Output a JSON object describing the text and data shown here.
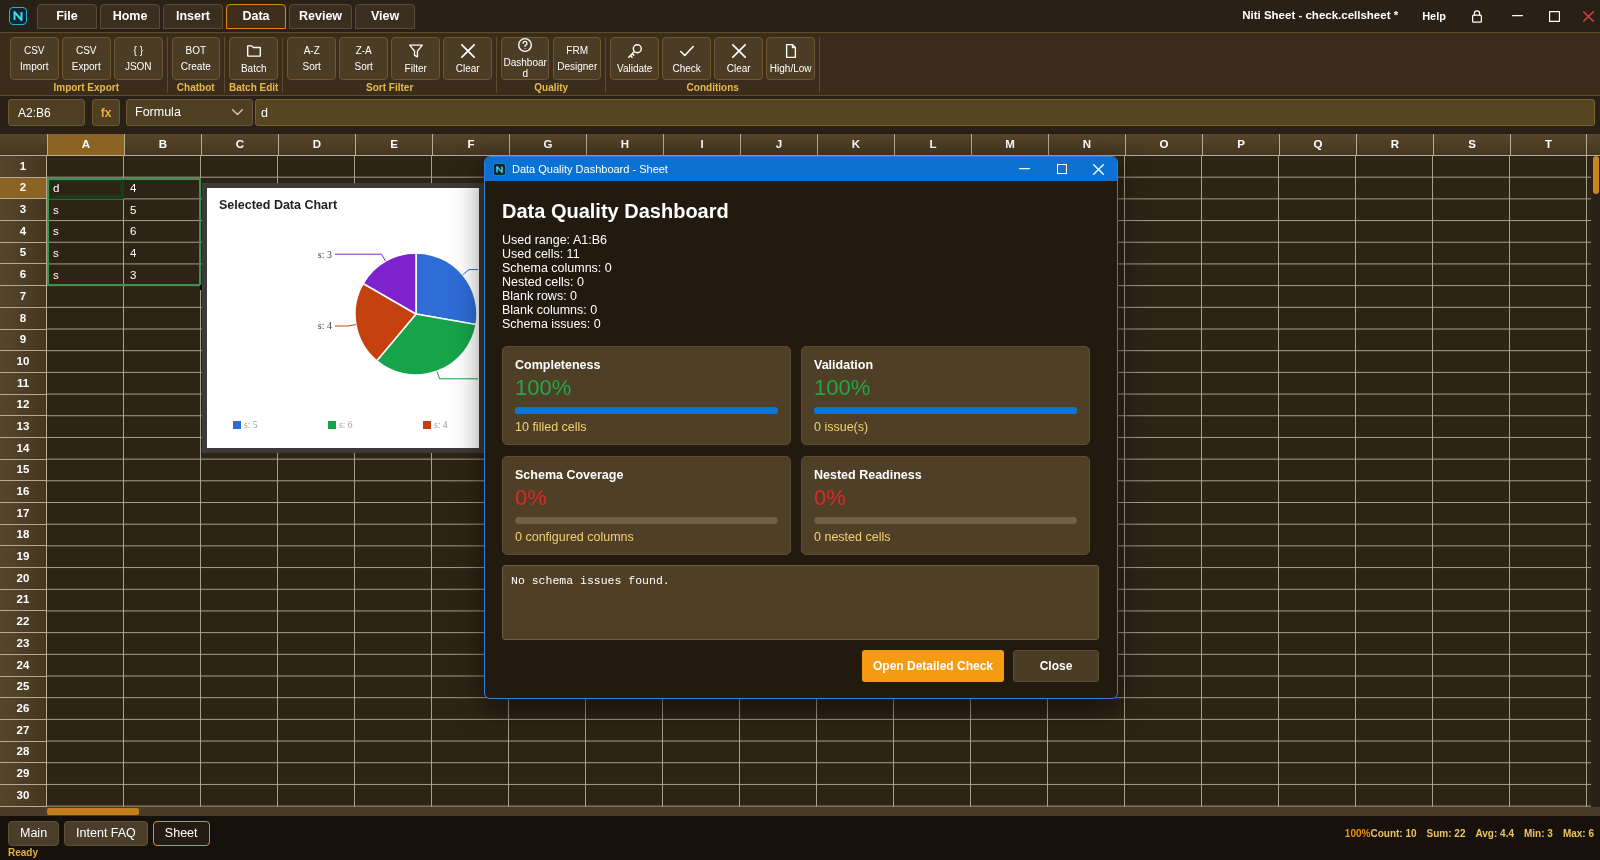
{
  "app": {
    "title": "Niti Sheet - check.cellsheet *",
    "help": "Help"
  },
  "menu_tabs": [
    {
      "label": "File",
      "selected": false
    },
    {
      "label": "Home",
      "selected": false
    },
    {
      "label": "Insert",
      "selected": false
    },
    {
      "label": "Data",
      "selected": true
    },
    {
      "label": "Review",
      "selected": false
    },
    {
      "label": "View",
      "selected": false
    }
  ],
  "ribbon": [
    {
      "label": "Import Export",
      "buttons": [
        {
          "kind": "caption",
          "caption": "CSV",
          "label": "Import"
        },
        {
          "kind": "caption",
          "caption": "CSV",
          "label": "Export"
        },
        {
          "kind": "caption",
          "caption": "{ }",
          "label": "JSON"
        }
      ]
    },
    {
      "label": "Chatbot",
      "buttons": [
        {
          "kind": "caption",
          "caption": "BOT",
          "label": "Create"
        }
      ]
    },
    {
      "label": "Batch Edit",
      "buttons": [
        {
          "kind": "folder",
          "label": "Batch"
        }
      ]
    },
    {
      "label": "Sort Filter",
      "buttons": [
        {
          "kind": "caption",
          "caption": "A-Z",
          "label": "Sort"
        },
        {
          "kind": "caption",
          "caption": "Z-A",
          "label": "Sort"
        },
        {
          "kind": "funnel",
          "label": "Filter"
        },
        {
          "kind": "cross",
          "label": "Clear"
        }
      ]
    },
    {
      "label": "Quality",
      "buttons": [
        {
          "kind": "help",
          "label": "Dashboard"
        },
        {
          "kind": "caption",
          "caption": "FRM",
          "label": "Designer"
        }
      ]
    },
    {
      "label": "Conditions",
      "buttons": [
        {
          "kind": "key",
          "label": "Validate"
        },
        {
          "kind": "tick",
          "label": "Check"
        },
        {
          "kind": "cross",
          "label": "Clear"
        },
        {
          "kind": "page",
          "label": "High/Low"
        }
      ]
    }
  ],
  "formula_bar": {
    "name_box": "A2:B6",
    "function_label": "fx",
    "mode": "Formula",
    "value": "d"
  },
  "sheet": {
    "columns": [
      {
        "label": "A",
        "selected": true
      },
      {
        "label": "B",
        "selected": false
      },
      {
        "label": "C",
        "selected": false
      },
      {
        "label": "D",
        "selected": false
      },
      {
        "label": "E",
        "selected": false
      },
      {
        "label": "F",
        "selected": false
      },
      {
        "label": "G",
        "selected": false
      },
      {
        "label": "H",
        "selected": false
      },
      {
        "label": "I",
        "selected": false
      },
      {
        "label": "J",
        "selected": false
      },
      {
        "label": "K",
        "selected": false
      },
      {
        "label": "L",
        "selected": false
      },
      {
        "label": "M",
        "selected": false
      },
      {
        "label": "N",
        "selected": false
      },
      {
        "label": "O",
        "selected": false
      },
      {
        "label": "P",
        "selected": false
      },
      {
        "label": "Q",
        "selected": false
      },
      {
        "label": "R",
        "selected": false
      },
      {
        "label": "S",
        "selected": false
      },
      {
        "label": "T",
        "selected": false
      }
    ],
    "rows": [
      {
        "label": "1",
        "selected": false
      },
      {
        "label": "2",
        "selected": true,
        "cells": [
          {
            "text": "d",
            "selected": true,
            "active": true
          },
          {
            "text": "4",
            "selected": true,
            "active": false
          }
        ]
      },
      {
        "label": "3",
        "selected": false,
        "cells": [
          {
            "text": "s",
            "selected": true,
            "active": false
          },
          {
            "text": "5",
            "selected": true,
            "active": false
          }
        ]
      },
      {
        "label": "4",
        "selected": false,
        "cells": [
          {
            "text": "s",
            "selected": true,
            "active": false
          },
          {
            "text": "6",
            "selected": true,
            "active": false
          }
        ]
      },
      {
        "label": "5",
        "selected": false,
        "cells": [
          {
            "text": "s",
            "selected": true,
            "active": false
          },
          {
            "text": "4",
            "selected": true,
            "active": false
          }
        ]
      },
      {
        "label": "6",
        "selected": false,
        "cells": [
          {
            "text": "s",
            "selected": true,
            "active": false
          },
          {
            "text": "3",
            "selected": true,
            "active": false
          }
        ]
      },
      {
        "label": "7",
        "selected": false
      },
      {
        "label": "8",
        "selected": false
      },
      {
        "label": "9",
        "selected": false
      },
      {
        "label": "10",
        "selected": false
      },
      {
        "label": "11",
        "selected": false
      },
      {
        "label": "12",
        "selected": false
      },
      {
        "label": "13",
        "selected": false
      },
      {
        "label": "14",
        "selected": false
      },
      {
        "label": "15",
        "selected": false
      },
      {
        "label": "16",
        "selected": false
      },
      {
        "label": "17",
        "selected": false
      },
      {
        "label": "18",
        "selected": false
      },
      {
        "label": "19",
        "selected": false
      },
      {
        "label": "20",
        "selected": false
      },
      {
        "label": "21",
        "selected": false
      },
      {
        "label": "22",
        "selected": false
      },
      {
        "label": "23",
        "selected": false
      },
      {
        "label": "24",
        "selected": false
      },
      {
        "label": "25",
        "selected": false
      },
      {
        "label": "26",
        "selected": false
      },
      {
        "label": "27",
        "selected": false
      },
      {
        "label": "28",
        "selected": false
      },
      {
        "label": "29",
        "selected": false
      },
      {
        "label": "30",
        "selected": false
      }
    ]
  },
  "chart": {
    "chart_data": {
      "type": "pie",
      "title": "Selected Data Chart",
      "categories": [
        "s: 5",
        "s: 6",
        "s: 4",
        "s: 3"
      ],
      "values": [
        5,
        6,
        4,
        3
      ],
      "colors": [
        "#2e6cd6",
        "#16a34a",
        "#c4400e",
        "#7e22ce"
      ],
      "legend": "bottom"
    }
  },
  "dialog": {
    "title": "Data Quality Dashboard - Sheet",
    "heading": "Data Quality Dashboard",
    "stats": [
      "Used range: A1:B6",
      "Used cells: 11",
      "Schema columns: 0",
      "Nested cells: 0",
      "Blank rows: 0",
      "Blank columns: 0",
      "Schema issues: 0"
    ],
    "metrics": [
      {
        "title": "Completeness",
        "value": "100%",
        "color": "#22a84a",
        "level": 1,
        "note": "10 filled cells"
      },
      {
        "title": "Validation",
        "value": "100%",
        "color": "#22a84a",
        "level": 1,
        "note": "0 issue(s)"
      },
      {
        "title": "Schema Coverage",
        "value": "0%",
        "color": "#e0282a",
        "level": 0,
        "note": "0 configured columns"
      },
      {
        "title": "Nested Readiness",
        "value": "0%",
        "color": "#e0282a",
        "level": 0,
        "note": "0 nested cells"
      }
    ],
    "report": "No schema issues found.",
    "buttons": [
      {
        "label": "Open Detailed Check",
        "kind": "primary"
      },
      {
        "label": "Close",
        "kind": "secondary"
      }
    ]
  },
  "sheet_tabs": [
    {
      "label": "Main",
      "selected": false
    },
    {
      "label": "Intent FAQ",
      "selected": false
    },
    {
      "label": "Sheet",
      "selected": true
    }
  ],
  "status_bar": {
    "message": "Ready",
    "zoom": "100%",
    "stats": [
      "Count: 10",
      "Sum: 22",
      "Avg: 4.4",
      "Min: 3",
      "Max: 6"
    ]
  }
}
